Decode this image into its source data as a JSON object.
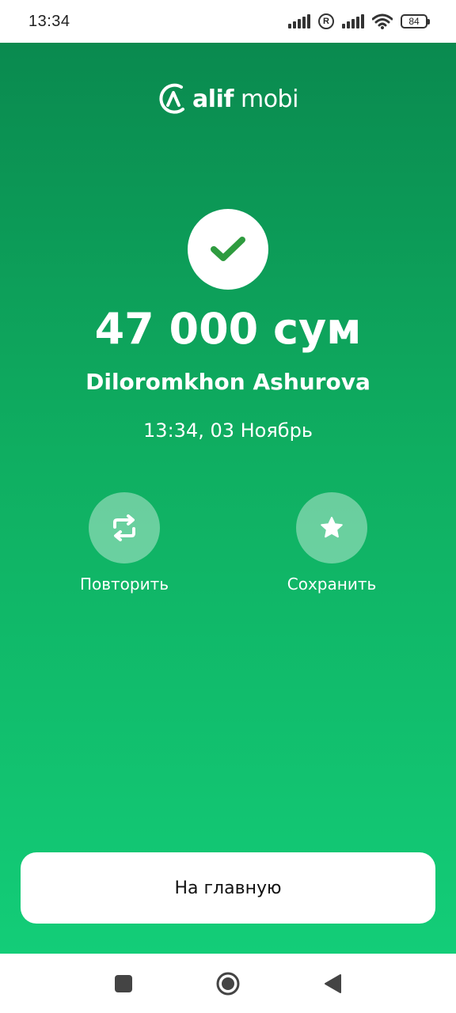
{
  "status_bar": {
    "time": "13:34",
    "battery_level": "84",
    "icons": [
      "signal-icon",
      "registered-icon",
      "signal-icon",
      "wifi-icon",
      "battery-icon"
    ]
  },
  "brand": {
    "name_bold": "alif",
    "name_regular": "mobi"
  },
  "transaction": {
    "amount": "47 000 сум",
    "recipient": "Diloromkhon Ashurova",
    "datetime": "13:34, 03 Ноябрь",
    "status_icon": "checkmark-icon"
  },
  "actions": [
    {
      "label": "Повторить",
      "icon": "repeat-icon"
    },
    {
      "label": "Сохранить",
      "icon": "star-icon"
    }
  ],
  "home_button": {
    "label": "На главную"
  },
  "nav_bar": {
    "icons": [
      "recents-icon",
      "home-icon",
      "back-icon"
    ]
  },
  "colors": {
    "gradient_top": "#0a8a4f",
    "gradient_bottom": "#13cd78",
    "check_green": "#2e9b3f"
  }
}
